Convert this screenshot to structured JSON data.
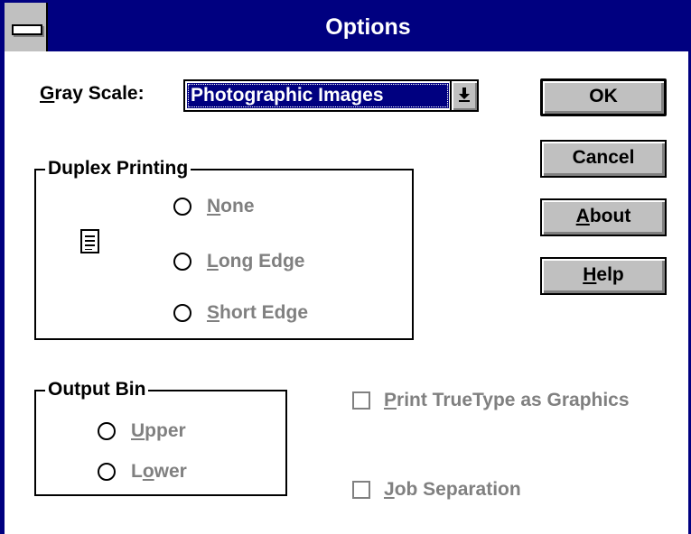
{
  "window": {
    "title": "Options"
  },
  "gray_scale": {
    "label_u": "G",
    "label_rest": "ray Scale:",
    "value": "Photographic Images"
  },
  "buttons": {
    "ok": "OK",
    "cancel": "Cancel",
    "about_u": "A",
    "about_rest": "bout",
    "help_u": "H",
    "help_rest": "elp"
  },
  "duplex": {
    "title": "Duplex Printing",
    "none_u": "N",
    "none_rest": "one",
    "long_u": "L",
    "long_rest": "ong Edge",
    "short_u": "S",
    "short_rest": "hort Edge"
  },
  "output_bin": {
    "title": "Output Bin",
    "upper_u": "U",
    "upper_rest": "pper",
    "lower_pre": "L",
    "lower_u": "o",
    "lower_rest": "wer"
  },
  "options": {
    "truetype_u": "P",
    "truetype_rest": "rint TrueType as Graphics",
    "jobsep_u": "J",
    "jobsep_rest": "ob Separation"
  }
}
